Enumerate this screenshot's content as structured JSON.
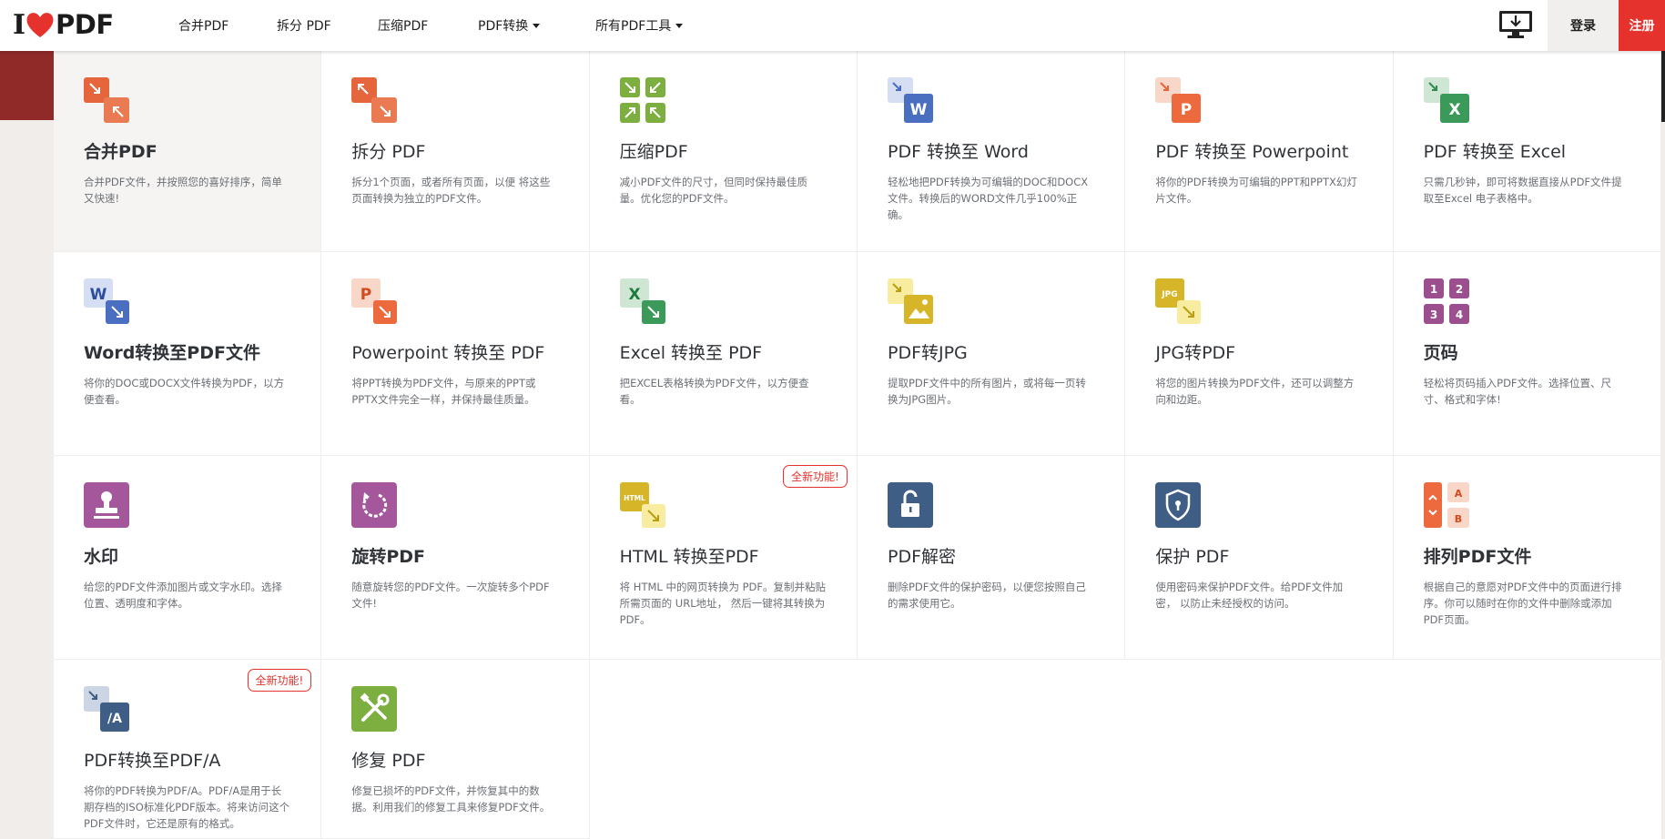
{
  "header": {
    "logo": {
      "left": "I",
      "right": "PDF"
    },
    "nav": [
      {
        "label": "合并PDF",
        "dropdown": false
      },
      {
        "label": "拆分 PDF",
        "dropdown": false
      },
      {
        "label": "压缩PDF",
        "dropdown": false
      },
      {
        "label": "PDF转换",
        "dropdown": true
      },
      {
        "label": "所有PDF工具",
        "dropdown": true
      }
    ],
    "login_label": "登录",
    "signup_label": "注册",
    "desktop_icon": "desktop-download-icon"
  },
  "colors": {
    "brand_red": "#e5322d",
    "merge": "#e5663c",
    "compress": "#7cae40",
    "word": "#4a6fc1",
    "powerpoint": "#e56a3a",
    "excel": "#2f8c4f",
    "jpg": "#d6b628",
    "pages": "#9b4f8f",
    "protect": "#3f5e86"
  },
  "tools": [
    {
      "title": "合并PDF",
      "desc": "合并PDF文件，并按照您的喜好排序，简单又快速!",
      "icon": "merge-icon",
      "badge": ""
    },
    {
      "title": "拆分 PDF",
      "desc": "拆分1个页面，或者所有页面，以便 将这些页面转换为独立的PDF文件。",
      "icon": "split-icon",
      "badge": ""
    },
    {
      "title": "压缩PDF",
      "desc": "减小PDF文件的尺寸，但同时保持最佳质量。优化您的PDF文件。",
      "icon": "compress-icon",
      "badge": ""
    },
    {
      "title": "PDF 转换至 Word",
      "desc": "轻松地把PDF转换为可编辑的DOC和DOCX文件。转换后的WORD文件几乎100%正确。",
      "icon": "pdf-to-word-icon",
      "badge": ""
    },
    {
      "title": "PDF 转换至 Powerpoint",
      "desc": "将你的PDF转换为可编辑的PPT和PPTX幻灯片文件。",
      "icon": "pdf-to-powerpoint-icon",
      "badge": ""
    },
    {
      "title": "PDF 转换至 Excel",
      "desc": "只需几秒钟，即可将数据直接从PDF文件提取至Excel 电子表格中。",
      "icon": "pdf-to-excel-icon",
      "badge": ""
    },
    {
      "title": "Word转换至PDF文件",
      "desc": "将你的DOC或DOCX文件转换为PDF，以方便查看。",
      "icon": "word-to-pdf-icon",
      "badge": ""
    },
    {
      "title": "Powerpoint 转换至 PDF",
      "desc": "将PPT转换为PDF文件，与原来的PPT或PPTX文件完全一样，并保持最佳质量。",
      "icon": "powerpoint-to-pdf-icon",
      "badge": ""
    },
    {
      "title": "Excel 转换至 PDF",
      "desc": "把EXCEL表格转换为PDF文件，以方便查看。",
      "icon": "excel-to-pdf-icon",
      "badge": ""
    },
    {
      "title": "PDF转JPG",
      "desc": "提取PDF文件中的所有图片，或将每一页转换为JPG图片。",
      "icon": "pdf-to-jpg-icon",
      "badge": ""
    },
    {
      "title": "JPG转PDF",
      "desc": "将您的图片转换为PDF文件，还可以调整方向和边距。",
      "icon": "jpg-to-pdf-icon",
      "badge": ""
    },
    {
      "title": "页码",
      "desc": "轻松将页码插入PDF文件。选择位置、尺寸、格式和字体!",
      "icon": "page-numbers-icon",
      "badge": ""
    },
    {
      "title": "水印",
      "desc": "给您的PDF文件添加图片或文字水印。选择位置、透明度和字体。",
      "icon": "watermark-icon",
      "badge": ""
    },
    {
      "title": "旋转PDF",
      "desc": "随意旋转您的PDF文件。一次旋转多个PDF文件!",
      "icon": "rotate-icon",
      "badge": ""
    },
    {
      "title": "HTML 转换至PDF",
      "desc": "将 HTML 中的网页转换为 PDF。复制并粘贴所需页面的 URL地址， 然后一键将其转换为 PDF。",
      "icon": "html-to-pdf-icon",
      "badge": "全新功能!"
    },
    {
      "title": "PDF解密",
      "desc": "删除PDF文件的保护密码，以便您按照自己的需求使用它。",
      "icon": "unlock-icon",
      "badge": ""
    },
    {
      "title": "保护 PDF",
      "desc": "使用密码来保护PDF文件。给PDF文件加密， 以防止未经授权的访问。",
      "icon": "protect-icon",
      "badge": ""
    },
    {
      "title": "排列PDF文件",
      "desc": "根据自己的意愿对PDF文件中的页面进行排序。你可以随时在你的文件中删除或添加PDF页面。",
      "icon": "organize-icon",
      "badge": ""
    },
    {
      "title": "PDF转换至PDF/A",
      "desc": "将你的PDF转换为PDF/A。PDF/A是用于长期存档的ISO标准化PDF版本。将来访问这个PDF文件时，它还是原有的格式。",
      "icon": "pdf-to-pdfa-icon",
      "badge": "全新功能!"
    },
    {
      "title": "修复 PDF",
      "desc": "修复已损坏的PDF文件，并恢复其中的数据。利用我们的修复工具来修复PDF文件。",
      "icon": "repair-icon",
      "badge": ""
    }
  ]
}
